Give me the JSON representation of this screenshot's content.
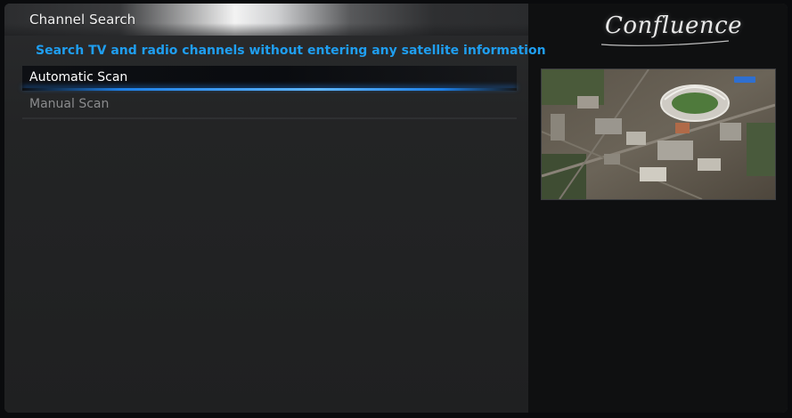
{
  "header": {
    "title": "Channel Search"
  },
  "description": "Search TV and radio channels without entering any satellite information",
  "menu": {
    "items": [
      {
        "label": "Automatic Scan",
        "selected": true
      },
      {
        "label": "Manual Scan",
        "selected": false
      }
    ]
  },
  "branding": {
    "logo_text": "Confluence"
  },
  "preview": {
    "icon": "tv-preview-image"
  },
  "colors": {
    "accent": "#1f9ef0",
    "selection_glow": "#1d7fe6"
  }
}
